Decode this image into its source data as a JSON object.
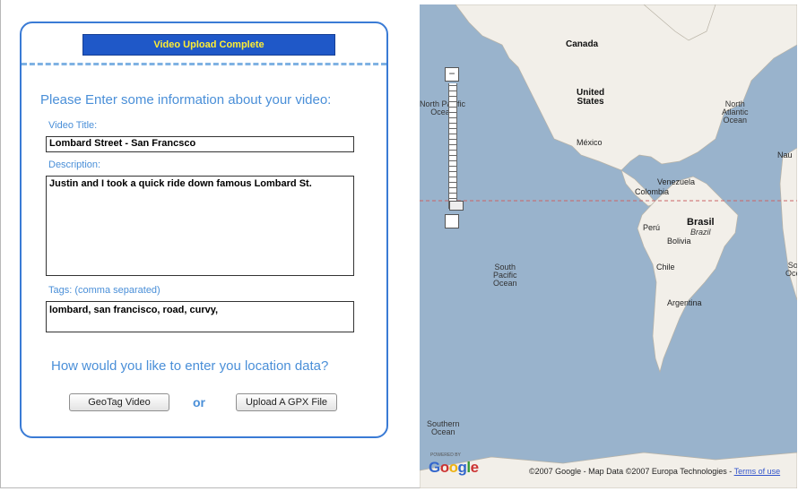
{
  "banner": {
    "title": "Video Upload Complete"
  },
  "form": {
    "heading": "Please Enter some information about your video:",
    "title_label": "Video Title:",
    "title_value": "Lombard Street -  San Francsco",
    "description_label": "Description:",
    "description_value": "Justin and I took a quick ride down famous Lombard St.",
    "tags_label": "Tags: (comma separated)",
    "tags_value": "lombard, san francisco, road, curvy,",
    "location_question": "How would you like to enter you location data?",
    "geotag_button": "GeoTag Video",
    "or_text": "or",
    "gpx_button": "Upload A GPX File"
  },
  "map": {
    "labels": {
      "canada": "Canada",
      "united_states": "United\nStates",
      "mexico": "México",
      "north_pacific": "North Pacific\nOcean",
      "north_atlantic": "North\nAtlantic\nOcean",
      "venezuela": "Venezuela",
      "colombia": "Colombia",
      "brasil": "Brasil",
      "brazil": "Brazil",
      "peru": "Perú",
      "bolivia": "Bolivia",
      "chile": "Chile",
      "argentina": "Argentina",
      "south_pacific": "South\nPacific\nOcean",
      "south_edge": "So\nOce",
      "southern_ocean": "Southern\nOcean",
      "nau": "Nau"
    },
    "zoom_in": "−",
    "powered_by": "POWERED BY",
    "logo_letters": [
      "G",
      "o",
      "o",
      "g",
      "l",
      "e"
    ],
    "logo_colors": [
      "#3366cc",
      "#cc3333",
      "#eeb211",
      "#3366cc",
      "#339933",
      "#cc3333"
    ],
    "copyright": "©2007 Google - Map Data ©2007 Europa Technologies - ",
    "terms_link": "Terms of use",
    "colors": {
      "ocean": "#99b3cc",
      "land": "#f2efe9",
      "equator": "#cc6666"
    }
  }
}
